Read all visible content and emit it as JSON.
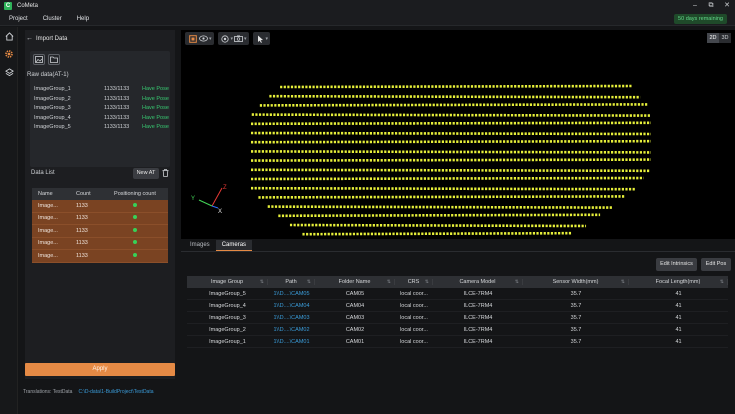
{
  "app": {
    "title": "CoMeta"
  },
  "window": {
    "controls": [
      "minimize-icon",
      "restore-icon",
      "close-icon"
    ]
  },
  "menu": {
    "items": [
      "Project",
      "Cluster",
      "Help"
    ],
    "trial": "50 days remaining"
  },
  "left_icons": [
    "home-icon",
    "settings-icon",
    "layers-icon"
  ],
  "panel": {
    "title": "Import Data",
    "raw_title": "Raw data(AT-1)",
    "raw_rows": [
      {
        "name": "ImageGroup_1",
        "count": "1133/1133",
        "status": "Have Pose"
      },
      {
        "name": "ImageGroup_2",
        "count": "1133/1133",
        "status": "Have Pose"
      },
      {
        "name": "ImageGroup_3",
        "count": "1133/1133",
        "status": "Have Pose"
      },
      {
        "name": "ImageGroup_4",
        "count": "1133/1133",
        "status": "Have Pose"
      },
      {
        "name": "ImageGroup_5",
        "count": "1133/1133",
        "status": "Have Pose"
      }
    ],
    "data_list_label": "Data List",
    "new_at_label": "New AT",
    "table": {
      "headers": [
        "Name",
        "Count",
        "Positioning count"
      ],
      "rows": [
        {
          "name": "Image...",
          "count": "1133"
        },
        {
          "name": "Image...",
          "count": "1133"
        },
        {
          "name": "Image...",
          "count": "1133"
        },
        {
          "name": "Image...",
          "count": "1133"
        },
        {
          "name": "Image...",
          "count": "1133"
        }
      ]
    },
    "apply_label": "Apply"
  },
  "status_bar": {
    "label": "Translations: TestData",
    "path": "C:\\D-data\\1-BuildProject\\TestData"
  },
  "viewer": {
    "mode_2d": "2D",
    "mode_3d": "3D",
    "axis_labels": [
      "Z",
      "Y",
      "X"
    ]
  },
  "tabs": {
    "images": "Images",
    "cameras": "Cameras"
  },
  "actions": {
    "edit_intrinsics": "Edit Intrinsics",
    "edit_pos": "Edit Pos"
  },
  "cameras_table": {
    "headers": [
      "Image Group",
      "Path",
      "Folder Name",
      "CRS",
      "Camera Model",
      "Sensor Width(mm)",
      "Focal Length(mm)"
    ],
    "rows": [
      {
        "group": "ImageGroup_5",
        "path": "1\\\\D....\\CAM05",
        "folder": "CAM05",
        "crs": "local coor...",
        "model": "ILCE-7RM4",
        "sensor": "35.7",
        "focal": "41"
      },
      {
        "group": "ImageGroup_4",
        "path": "1\\\\D....\\CAM04",
        "folder": "CAM04",
        "crs": "local coor...",
        "model": "ILCE-7RM4",
        "sensor": "35.7",
        "focal": "41"
      },
      {
        "group": "ImageGroup_3",
        "path": "1\\\\D....\\CAM03",
        "folder": "CAM03",
        "crs": "local coor...",
        "model": "ILCE-7RM4",
        "sensor": "35.7",
        "focal": "41"
      },
      {
        "group": "ImageGroup_2",
        "path": "1\\\\D....\\CAM02",
        "folder": "CAM02",
        "crs": "local coor...",
        "model": "ILCE-7RM4",
        "sensor": "35.7",
        "focal": "41"
      },
      {
        "group": "ImageGroup_1",
        "path": "1\\\\D....\\CAM01",
        "folder": "CAM01",
        "crs": "local coor...",
        "model": "ILCE-7RM4",
        "sensor": "35.7",
        "focal": "41"
      }
    ]
  },
  "colors": {
    "accent": "#e58a45",
    "success": "#37c871",
    "link": "#3a9bd8",
    "point": "#e7f03a",
    "row_selected": "#7a4322"
  }
}
